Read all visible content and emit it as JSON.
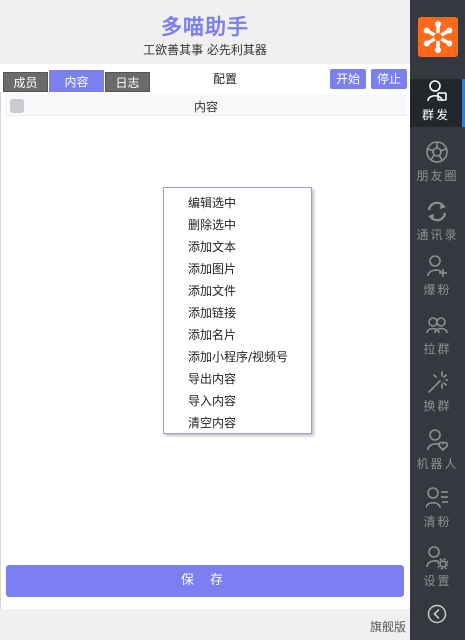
{
  "app": {
    "title": "多喵助手",
    "subtitle": "工欲善其事 必先利其器"
  },
  "tabs": [
    {
      "label": "成员"
    },
    {
      "label": "内容"
    },
    {
      "label": "日志"
    }
  ],
  "toolbar": {
    "config_label": "配置",
    "start_label": "开始",
    "stop_label": "停止"
  },
  "list": {
    "column_header": "内容"
  },
  "context_menu": {
    "items": [
      "编辑选中",
      "删除选中",
      "添加文本",
      "添加图片",
      "添加文件",
      "添加链接",
      "添加名片",
      "添加小程序/视频号",
      "导出内容",
      "导入内容",
      "清空内容"
    ]
  },
  "save_label": "保 存",
  "footer": {
    "edition": "旗舰版"
  },
  "sidebar": {
    "items": [
      {
        "label": "群发",
        "icon": "broadcast-icon"
      },
      {
        "label": "朋友圈",
        "icon": "moments-icon"
      },
      {
        "label": "通讯录",
        "icon": "sync-contacts-icon"
      },
      {
        "label": "爆粉",
        "icon": "add-user-icon"
      },
      {
        "label": "拉群",
        "icon": "group-icon"
      },
      {
        "label": "换群",
        "icon": "magic-wand-icon"
      },
      {
        "label": "机器人",
        "icon": "robot-user-icon"
      },
      {
        "label": "清粉",
        "icon": "user-list-icon"
      },
      {
        "label": "设置",
        "icon": "user-settings-icon"
      }
    ]
  },
  "colors": {
    "accent": "#7b7ff0",
    "sidebar_bg": "#34393f",
    "logo": "#ff6a1a"
  }
}
